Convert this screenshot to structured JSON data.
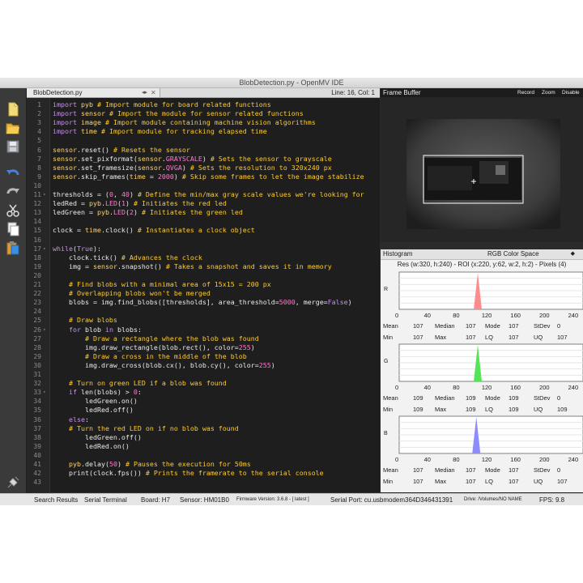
{
  "window": {
    "title": "BlobDetection.py - OpenMV IDE"
  },
  "toolbar": {
    "icons": [
      "new-file-icon",
      "open-folder-icon",
      "save-icon",
      "undo-icon",
      "redo-icon",
      "cut-icon",
      "copy-icon",
      "paste-icon",
      "connect-icon",
      "disconnect-icon"
    ]
  },
  "editor": {
    "tab_name": "BlobDetection.py",
    "cursor": "Line: 16, Col: 1",
    "lines": [
      {
        "n": "1",
        "t": "import pyb # Import module for board related functions"
      },
      {
        "n": "2",
        "t": "import sensor # Import the module for sensor related functions"
      },
      {
        "n": "3",
        "t": "import image # Import module containing machine vision algorithms"
      },
      {
        "n": "4",
        "t": "import time # Import module for tracking elapsed time"
      },
      {
        "n": "5",
        "t": ""
      },
      {
        "n": "6",
        "t": "sensor.reset() # Resets the sensor"
      },
      {
        "n": "7",
        "t": "sensor.set_pixformat(sensor.GRAYSCALE) # Sets the sensor to grayscale"
      },
      {
        "n": "8",
        "t": "sensor.set_framesize(sensor.QVGA) # Sets the resolution to 320x240 px"
      },
      {
        "n": "9",
        "t": "sensor.skip_frames(time = 2000) # Skip some frames to let the image stabilize"
      },
      {
        "n": "10",
        "t": ""
      },
      {
        "n": "11",
        "t": "thresholds = (0, 40) # Define the min/max gray scale values we're looking for"
      },
      {
        "n": "12",
        "t": "ledRed = pyb.LED(1) # Initiates the red led"
      },
      {
        "n": "13",
        "t": "ledGreen = pyb.LED(2) # Initiates the green led"
      },
      {
        "n": "14",
        "t": ""
      },
      {
        "n": "15",
        "t": "clock = time.clock() # Instantiates a clock object"
      },
      {
        "n": "16",
        "t": ""
      },
      {
        "n": "17",
        "t": "while(True):"
      },
      {
        "n": "18",
        "t": "    clock.tick() # Advances the clock"
      },
      {
        "n": "19",
        "t": "    img = sensor.snapshot() # Takes a snapshot and saves it in memory"
      },
      {
        "n": "20",
        "t": ""
      },
      {
        "n": "21",
        "t": "    # Find blobs with a minimal area of 15x15 = 200 px"
      },
      {
        "n": "22",
        "t": "    # Overlapping blobs won't be merged"
      },
      {
        "n": "23",
        "t": "    blobs = img.find_blobs([thresholds], area_threshold=5000, merge=False)"
      },
      {
        "n": "24",
        "t": ""
      },
      {
        "n": "25",
        "t": "    # Draw blobs"
      },
      {
        "n": "26",
        "t": "    for blob in blobs:"
      },
      {
        "n": "27",
        "t": "        # Draw a rectangle where the blob was found"
      },
      {
        "n": "28",
        "t": "        img.draw_rectangle(blob.rect(), color=255)"
      },
      {
        "n": "29",
        "t": "        # Draw a cross in the middle of the blob"
      },
      {
        "n": "30",
        "t": "        img.draw_cross(blob.cx(), blob.cy(), color=255)"
      },
      {
        "n": "31",
        "t": ""
      },
      {
        "n": "32",
        "t": "    # Turn on green LED if a blob was found"
      },
      {
        "n": "33",
        "t": "    if len(blobs) > 0:"
      },
      {
        "n": "34",
        "t": "        ledGreen.on()"
      },
      {
        "n": "35",
        "t": "        ledRed.off()"
      },
      {
        "n": "36",
        "t": "    else:"
      },
      {
        "n": "37",
        "t": "    # Turn the red LED on if no blob was found"
      },
      {
        "n": "38",
        "t": "        ledGreen.off()"
      },
      {
        "n": "39",
        "t": "        ledRed.on()"
      },
      {
        "n": "40",
        "t": ""
      },
      {
        "n": "41",
        "t": "    pyb.delay(50) # Pauses the execution for 50ms"
      },
      {
        "n": "42",
        "t": "    print(clock.fps()) # Prints the framerate to the serial console"
      },
      {
        "n": "43",
        "t": ""
      }
    ]
  },
  "frame_buffer": {
    "title": "Frame Buffer",
    "record": "Record",
    "zoom": "Zoom",
    "disable": "Disable"
  },
  "histogram": {
    "title": "Histogram",
    "color_space": "RGB Color Space",
    "resolution": "Res (w:320, h:240) - ROI (x:220, y:62, w:2, h:2) - Pixels (4)",
    "ticks": [
      "0",
      "40",
      "80",
      "120",
      "160",
      "200",
      "240"
    ],
    "channels": [
      {
        "axis": "R",
        "color": "#ff8c8c",
        "peak": 109,
        "stats": {
          "Mean": "107",
          "Median": "107",
          "Mode": "107",
          "StDev": "0",
          "Min": "107",
          "Max": "107",
          "LQ": "107",
          "UQ": "107"
        }
      },
      {
        "axis": "G",
        "color": "#55e455",
        "peak": 109,
        "stats": {
          "Mean": "109",
          "Median": "109",
          "Mode": "109",
          "StDev": "0",
          "Min": "109",
          "Max": "109",
          "LQ": "109",
          "UQ": "109"
        }
      },
      {
        "axis": "B",
        "color": "#8c8cff",
        "peak": 107,
        "stats": {
          "Mean": "107",
          "Median": "107",
          "Mode": "107",
          "StDev": "0",
          "Min": "107",
          "Max": "107",
          "LQ": "107",
          "UQ": "107"
        }
      }
    ]
  },
  "statusbar": {
    "search_results": "Search Results",
    "serial_terminal": "Serial Terminal",
    "board": "Board: H7",
    "sensor": "Sensor: HM01B0",
    "firmware": "Firmware Version: 3.6.8 - [ latest ]",
    "serial_port": "Serial Port: cu.usbmodem364D346431391",
    "drive": "Drive: /Volumes/NO NAME",
    "fps": "FPS:  9.8"
  }
}
